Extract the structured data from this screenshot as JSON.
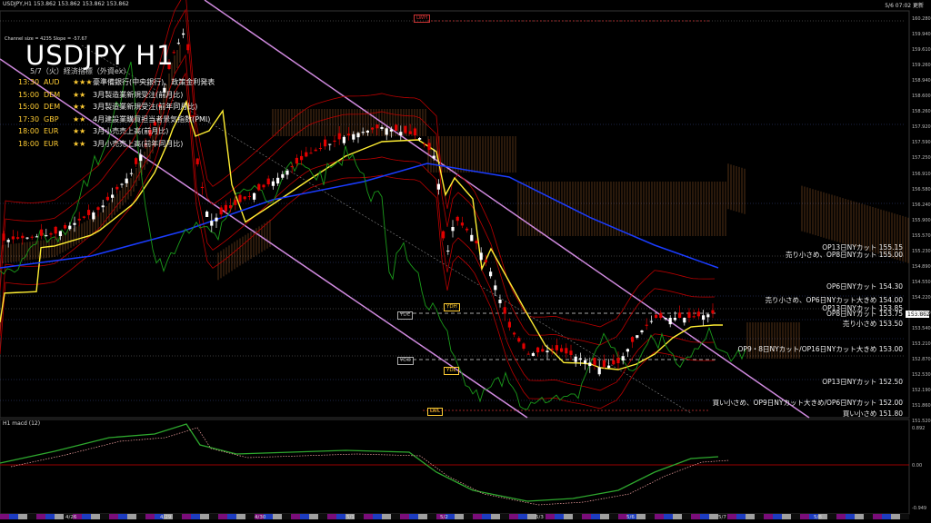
{
  "header": {
    "symbol_line": "USDJPY,H1  153.862 153.862 153.862 153.862",
    "datetime": "5/6 07:02 更新"
  },
  "channel_info": "Channel size = 4235 Slope = -57.67",
  "title": "USDJPY H1",
  "events_heading": "5/7（火）経済指標（外資ex）",
  "events": [
    {
      "time": "13:30",
      "country": "AUD",
      "stars": "★★★",
      "name": "豪準備銀行(中央銀行)、政策金利発表"
    },
    {
      "time": "15:00",
      "country": "DEM",
      "stars": "★★",
      "name": "3月製造業新規受注(前月比)"
    },
    {
      "time": "15:00",
      "country": "DEM",
      "stars": "★★",
      "name": "3月製造業新規受注(前年同月比)"
    },
    {
      "time": "17:30",
      "country": "GBP",
      "stars": "★★",
      "name": "4月建設業購買担当者景気指数(PMI)"
    },
    {
      "time": "18:00",
      "country": "EUR",
      "stars": "★★",
      "name": "3月小売売上高(前月比)"
    },
    {
      "time": "18:00",
      "country": "EUR",
      "stars": "★★",
      "name": "3月小売売上高(前年同月比)"
    }
  ],
  "level_labels": [
    {
      "text": "OP13日NYカット 155.15"
    },
    {
      "text": "売り小さめ、OP8日NYカット 155.00"
    },
    {
      "text": "OP6日NYカット 154.30"
    },
    {
      "text": "売り小さめ、OP6日NYカット大きめ 154.00"
    },
    {
      "text": "OP13日NYカット 153.85"
    },
    {
      "text": "OP8日NYカット 153.75"
    },
    {
      "text": "売り小さめ 153.50"
    },
    {
      "text": "OP9・8日NYカット/OP16日NYカット大きめ 153.00"
    },
    {
      "text": "OP13日NYカット 152.50"
    },
    {
      "text": "買い小さめ、OP9日NYカット大きめ/OP6日NYカット 152.00"
    },
    {
      "text": "買い小さめ 151.80"
    }
  ],
  "box_labels": {
    "lwh": "LWH",
    "ydc": "YDC",
    "ydh": "YDH",
    "ydo": "YDO",
    "ydl": "YDL",
    "lwl": "LWL"
  },
  "price_ticks": [
    "160.280",
    "159.940",
    "159.610",
    "159.260",
    "158.940",
    "158.600",
    "158.260",
    "157.920",
    "157.590",
    "157.250",
    "156.910",
    "156.580",
    "156.240",
    "155.900",
    "155.570",
    "155.230",
    "154.890",
    "154.550",
    "154.220",
    "153.880",
    "153.540",
    "153.210",
    "152.870",
    "152.530",
    "152.190",
    "151.860",
    "151.520"
  ],
  "current_price": "153.862",
  "sub_label": "H1 macd (12)",
  "sub_ticks": [
    "0.892",
    "0.00",
    "-0.949"
  ],
  "date_ticks": [
    "4/26",
    "4/29",
    "4/30",
    "5/1",
    "5/2",
    "5/3",
    "5/6",
    "5/7",
    "5/8"
  ],
  "colors": {
    "bull": "#ffffff",
    "bear": "#e00000",
    "ma_yellow": "#ffee33",
    "ma_blue": "#1a3cff",
    "channel": "#d08adf",
    "cloud": "#ff9944",
    "macd": "#2ea82e",
    "signal": "#ffaaaa"
  }
}
